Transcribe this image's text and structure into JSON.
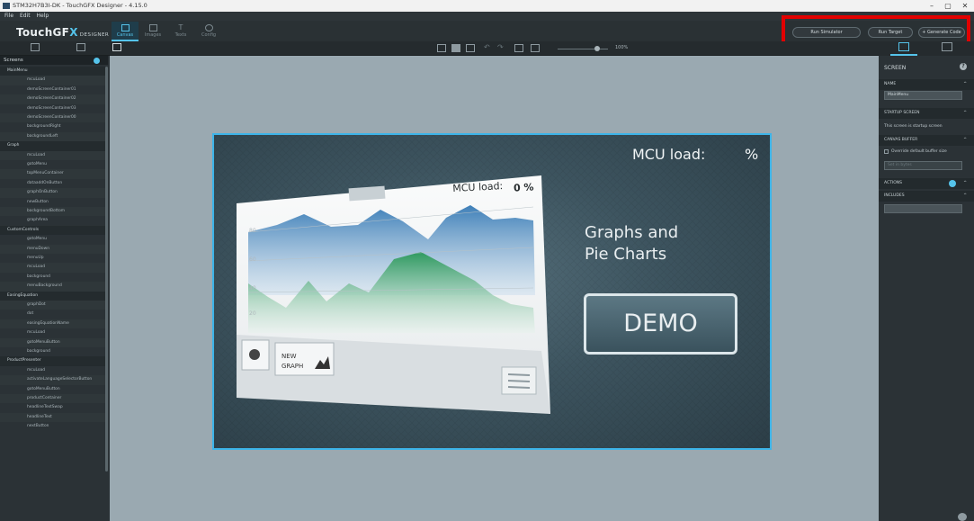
{
  "window": {
    "title": "STM32H7B3I-DK - TouchGFX Designer - 4.15.0",
    "minimize": "–",
    "maximize": "▢",
    "close": "✕"
  },
  "menu": [
    "File",
    "Edit",
    "Help"
  ],
  "app": {
    "logo_main": "TouchGF",
    "logo_x": "X",
    "logo_sub": "DESIGNER"
  },
  "nav_tabs": [
    {
      "label": "Canvas",
      "icon": "canvas-icon"
    },
    {
      "label": "Images",
      "icon": "images-icon"
    },
    {
      "label": "Texts",
      "icon": "texts-icon"
    },
    {
      "label": "Config",
      "icon": "config-icon"
    }
  ],
  "top_buttons": {
    "run_simulator": "Run Simulator",
    "run_target": "Run Target",
    "generate_code": "+ Generate Code"
  },
  "zoom": {
    "label": "100%"
  },
  "screens_panel": {
    "title": "Screens",
    "items": [
      {
        "label": "MainMenu",
        "type": "screen"
      },
      {
        "label": "mcuLoad",
        "type": "child"
      },
      {
        "label": "demoScreenContainer01",
        "type": "child"
      },
      {
        "label": "demoScreenContainer02",
        "type": "child"
      },
      {
        "label": "demoScreenContainer03",
        "type": "child"
      },
      {
        "label": "demoScreenContainer00",
        "type": "child"
      },
      {
        "label": "backgroundRight",
        "type": "child"
      },
      {
        "label": "backgroundLeft",
        "type": "child"
      },
      {
        "label": "Graph",
        "type": "screen"
      },
      {
        "label": "mcuLoad",
        "type": "child"
      },
      {
        "label": "gotoMenu",
        "type": "child"
      },
      {
        "label": "topMenuContainer",
        "type": "child"
      },
      {
        "label": "dataaddOnButton",
        "type": "child"
      },
      {
        "label": "graphOnButton",
        "type": "child"
      },
      {
        "label": "newButton",
        "type": "child"
      },
      {
        "label": "backgroundBottom",
        "type": "child"
      },
      {
        "label": "graphArea",
        "type": "child"
      },
      {
        "label": "CustomControls",
        "type": "screen"
      },
      {
        "label": "gotoMenu",
        "type": "child"
      },
      {
        "label": "menuDown",
        "type": "child"
      },
      {
        "label": "menuUp",
        "type": "child"
      },
      {
        "label": "mcuLoad",
        "type": "child"
      },
      {
        "label": "background",
        "type": "child"
      },
      {
        "label": "menuBackground",
        "type": "child"
      },
      {
        "label": "EasingEquation",
        "type": "screen"
      },
      {
        "label": "graphDot",
        "type": "child"
      },
      {
        "label": "dot",
        "type": "child"
      },
      {
        "label": "easingEquationName",
        "type": "child"
      },
      {
        "label": "mcuLoad",
        "type": "child"
      },
      {
        "label": "gotoMenuButton",
        "type": "child"
      },
      {
        "label": "background",
        "type": "child"
      },
      {
        "label": "ProductPresenter",
        "type": "screen"
      },
      {
        "label": "mcuLoad",
        "type": "child"
      },
      {
        "label": "activateLanguageSelectorButton",
        "type": "child"
      },
      {
        "label": "gotoMenuButton",
        "type": "child"
      },
      {
        "label": "productContainer",
        "type": "child"
      },
      {
        "label": "headlineTextSwap",
        "type": "child"
      },
      {
        "label": "headlineText",
        "type": "child"
      },
      {
        "label": "nextButton",
        "type": "child"
      }
    ]
  },
  "preview": {
    "mcu_label": "MCU load:",
    "mcu_unit": "%",
    "mcu_small_label": "MCU load:",
    "mcu_small_value": "0 %",
    "heading_line1": "Graphs and",
    "heading_line2": "Pie Charts",
    "demo_button": "DEMO",
    "new_graph_line1": "NEW",
    "new_graph_line2": "GRAPH"
  },
  "properties": {
    "title": "SCREEN",
    "help": "?",
    "name_section": "NAME",
    "name_value": "MainMenu",
    "startup_section": "STARTUP SCREEN",
    "startup_text": "This screen is startup screen",
    "canvas_section": "CANVAS BUFFER",
    "canvas_checkbox": "Override default buffer size",
    "canvas_input": "Set in bytes",
    "actions_section": "ACTIONS",
    "includes_section": "INCLUDES"
  },
  "colors": {
    "accent": "#55c3ea",
    "highlight": "#e20000"
  }
}
